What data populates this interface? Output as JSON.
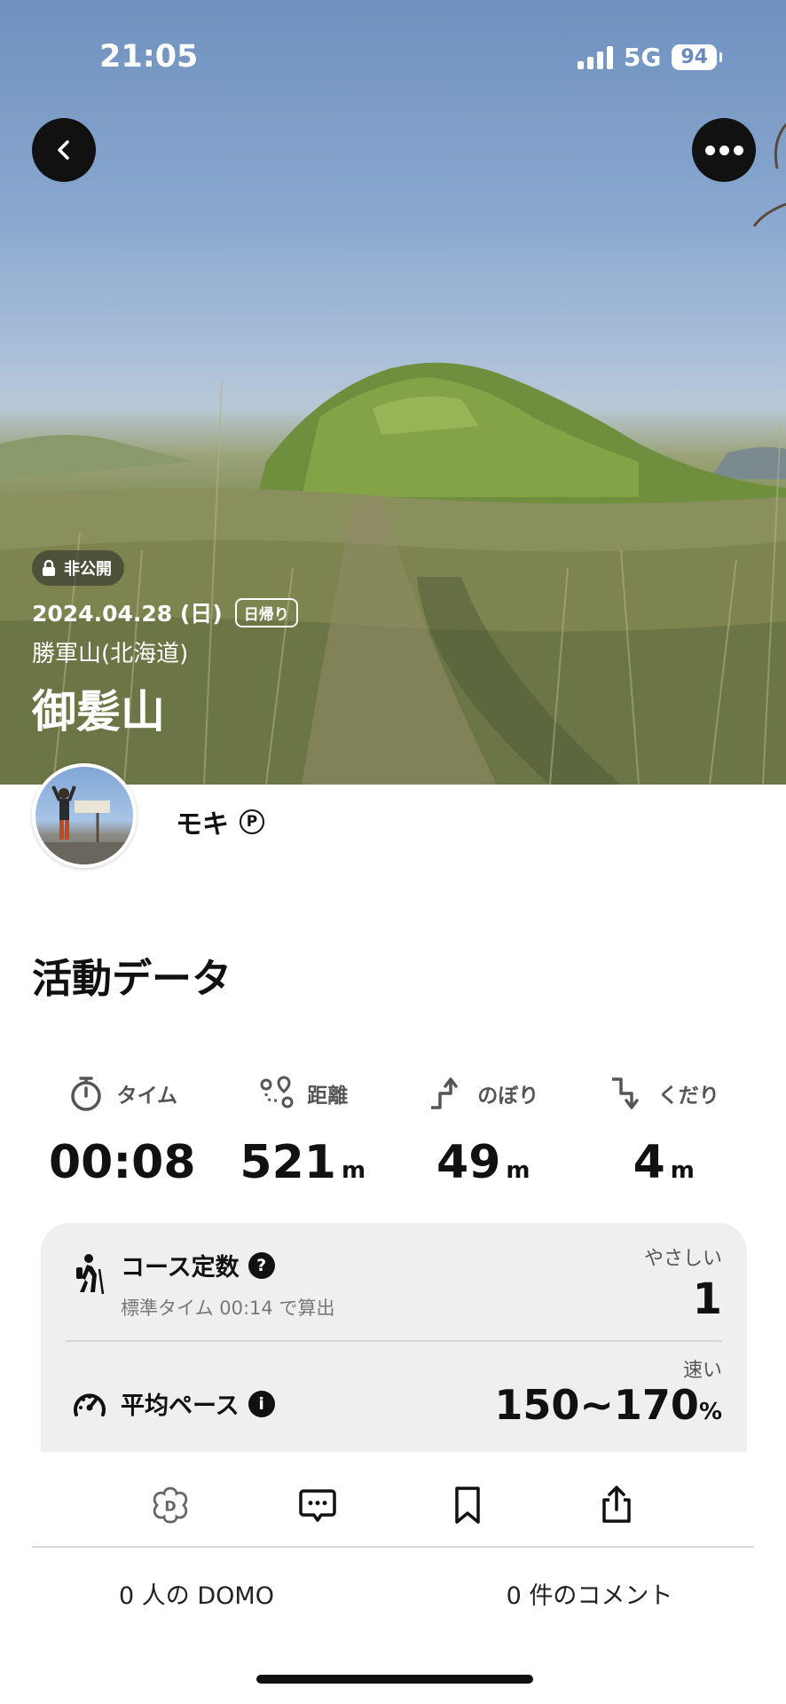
{
  "status_bar": {
    "time": "21:05",
    "network": "5G",
    "battery": "94"
  },
  "header": {
    "back_icon": "chevron-left-icon",
    "more_icon": "ellipsis-icon"
  },
  "activity": {
    "privacy": "非公開",
    "date": "2024.04.28 (日)",
    "trip_type": "日帰り",
    "area": "勝軍山(北海道)",
    "mountain": "御髪山"
  },
  "user": {
    "name": "モキ",
    "badge": "P"
  },
  "section_title": "活動データ",
  "stats": [
    {
      "icon": "stopwatch-icon",
      "label": "タイム",
      "value": "00:08",
      "unit": ""
    },
    {
      "icon": "route-icon",
      "label": "距離",
      "value": "521",
      "unit": "m"
    },
    {
      "icon": "ascent-icon",
      "label": "のぼり",
      "value": "49",
      "unit": "m"
    },
    {
      "icon": "descent-icon",
      "label": "くだり",
      "value": "4",
      "unit": "m"
    }
  ],
  "course_constant": {
    "title": "コース定数",
    "subtitle": "標準タイム 00:14 で算出",
    "level": "やさしい",
    "value": "1"
  },
  "pace": {
    "title": "平均ペース",
    "level": "速い",
    "value": "150~170",
    "unit": "%"
  },
  "actions": [
    "domo-icon",
    "comment-icon",
    "bookmark-icon",
    "share-icon"
  ],
  "counts": {
    "domo": "0 人の DOMO",
    "comments": "0 件のコメント"
  },
  "colors": {
    "hero_sky": "#7f9dc7",
    "card_bg": "#efefef",
    "text": "#111111"
  }
}
